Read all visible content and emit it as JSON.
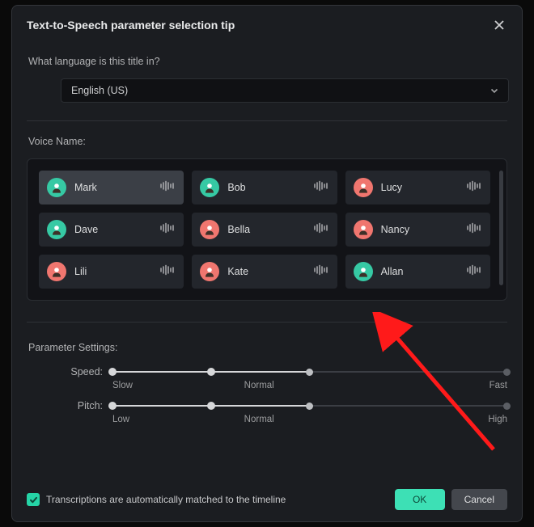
{
  "dialog": {
    "title": "Text-to-Speech parameter selection tip",
    "question": "What language is this title in?",
    "language_selected": "English (US)",
    "voice_section_label": "Voice Name:",
    "params_section_label": "Parameter Settings:",
    "checkbox_label": "Transcriptions are automatically matched to the timeline",
    "checkbox_checked": true,
    "ok_label": "OK",
    "cancel_label": "Cancel"
  },
  "voices": [
    {
      "name": "Mark",
      "gender": "male",
      "selected": true
    },
    {
      "name": "Bob",
      "gender": "male",
      "selected": false
    },
    {
      "name": "Lucy",
      "gender": "female",
      "selected": false
    },
    {
      "name": "Dave",
      "gender": "male",
      "selected": false
    },
    {
      "name": "Bella",
      "gender": "female",
      "selected": false
    },
    {
      "name": "Nancy",
      "gender": "female",
      "selected": false
    },
    {
      "name": "Lili",
      "gender": "female",
      "selected": false
    },
    {
      "name": "Kate",
      "gender": "female",
      "selected": false
    },
    {
      "name": "Allan",
      "gender": "male",
      "selected": false
    }
  ],
  "sliders": {
    "speed": {
      "label": "Speed:",
      "value_percent": 50,
      "ticks": {
        "low": "Slow",
        "mid": "Normal",
        "high": "Fast"
      }
    },
    "pitch": {
      "label": "Pitch:",
      "value_percent": 50,
      "ticks": {
        "low": "Low",
        "mid": "Normal",
        "high": "High"
      }
    }
  },
  "colors": {
    "accent": "#3de0b5",
    "panel": "#1b1d21",
    "card": "#23262c"
  }
}
